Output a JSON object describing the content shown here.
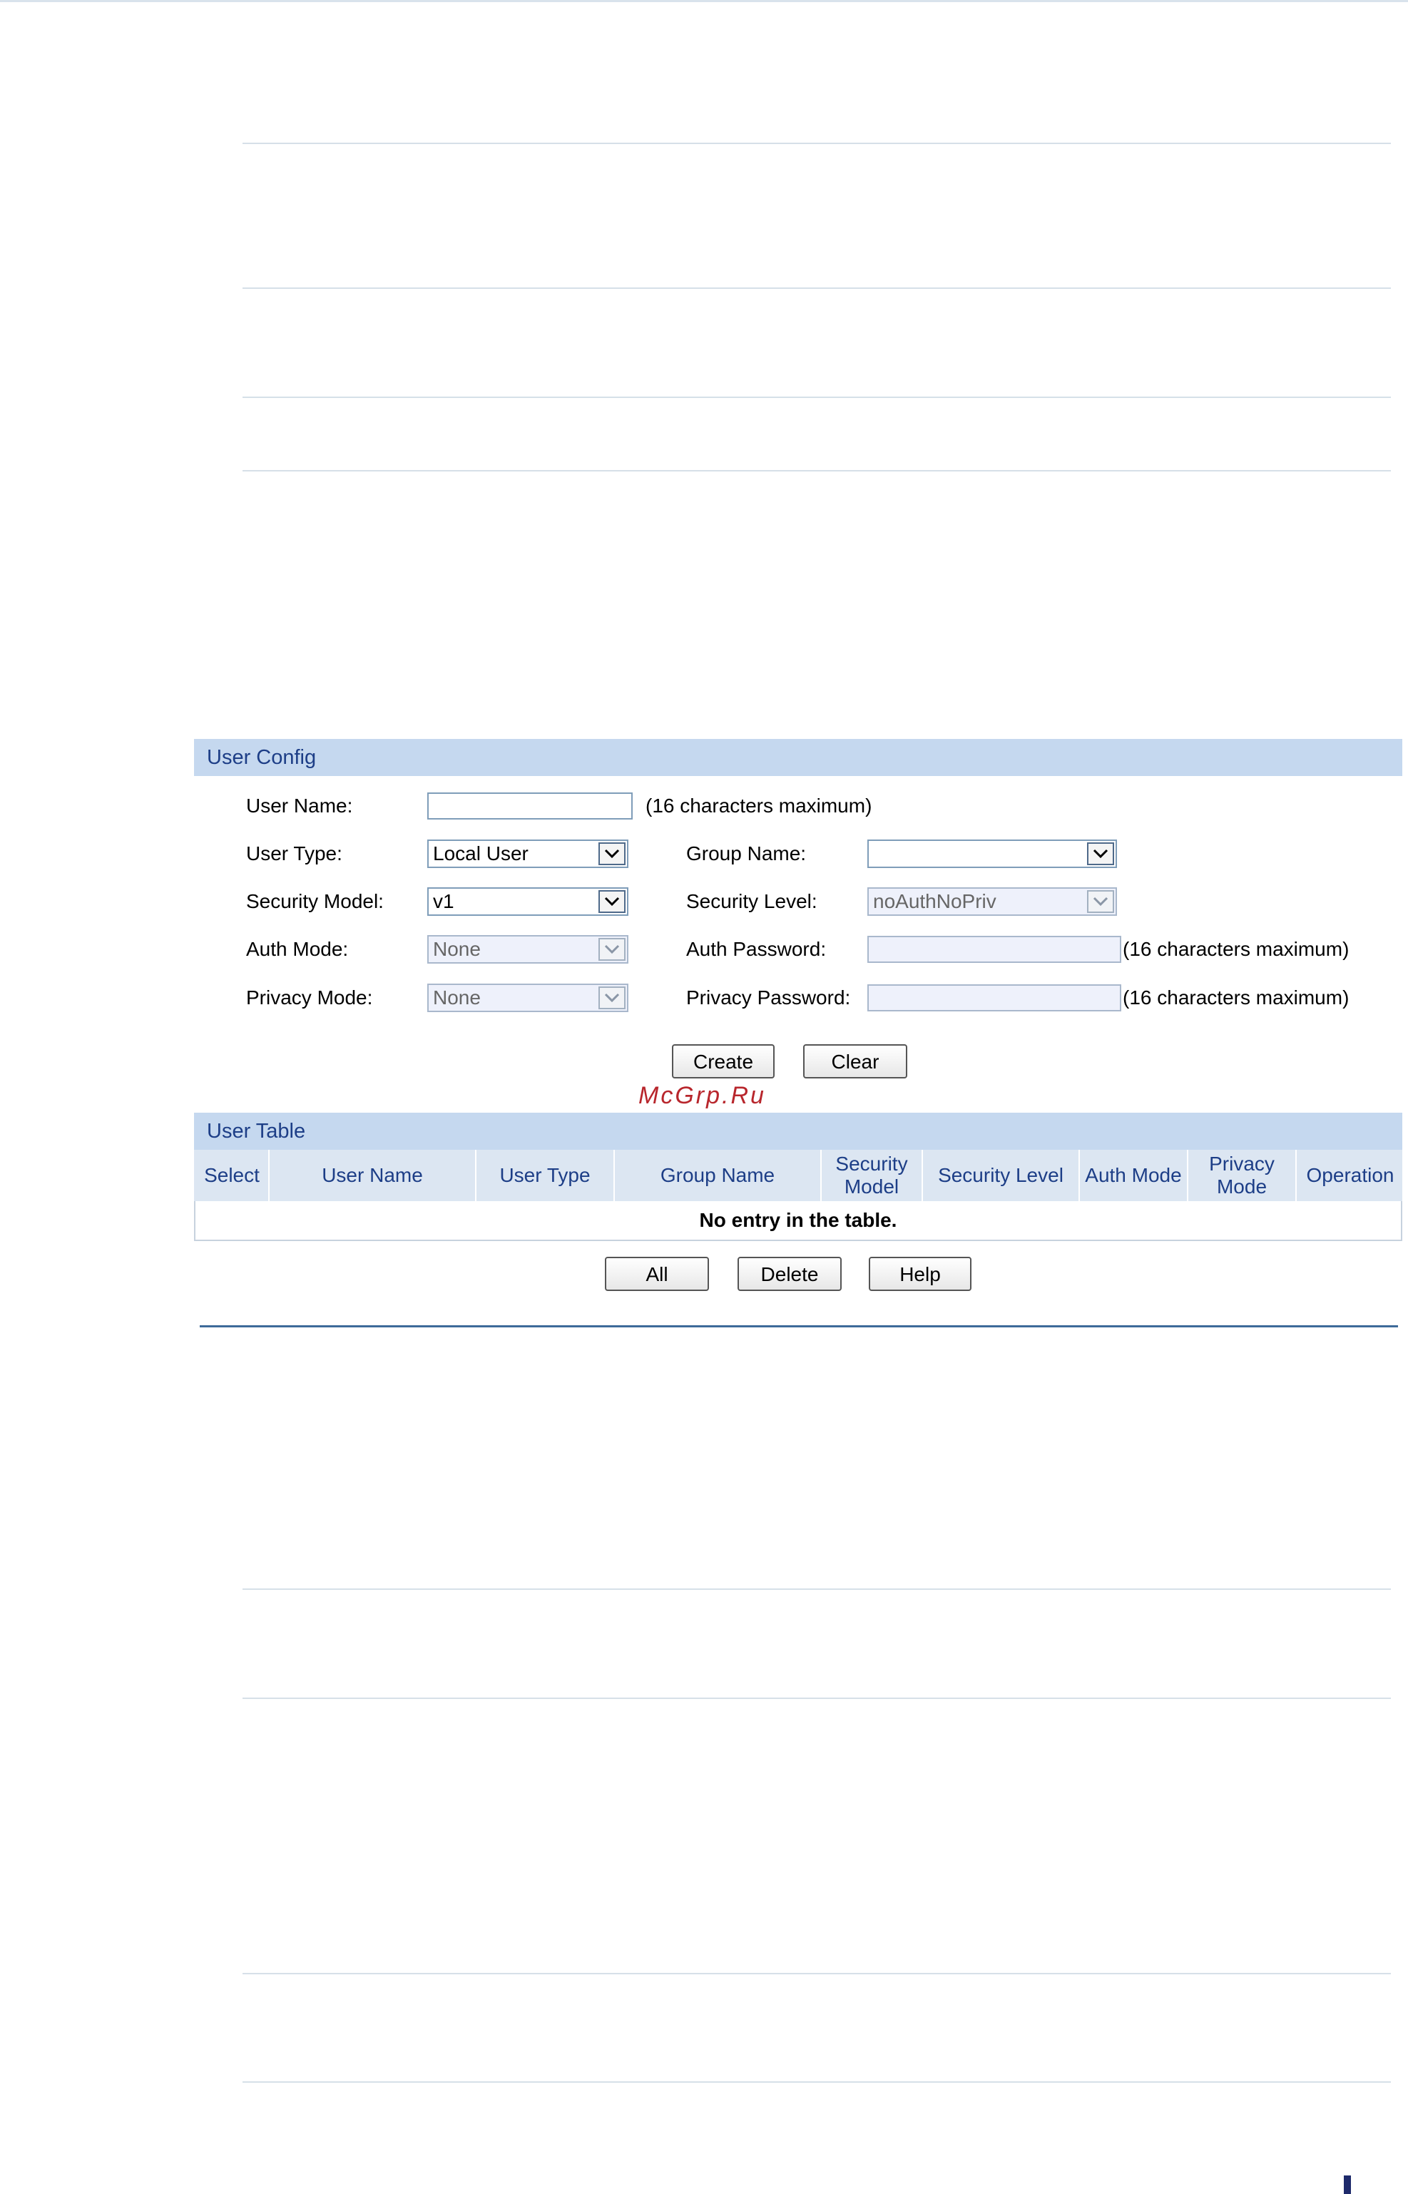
{
  "user_config": {
    "header": "User Config",
    "user_name_label": "User Name:",
    "user_name_value": "",
    "user_name_hint": "(16 characters maximum)",
    "user_type_label": "User Type:",
    "user_type_value": "Local User",
    "group_name_label": "Group Name:",
    "group_name_value": "",
    "security_model_label": "Security Model:",
    "security_model_value": "v1",
    "security_level_label": "Security Level:",
    "security_level_value": "noAuthNoPriv",
    "auth_mode_label": "Auth Mode:",
    "auth_mode_value": "None",
    "auth_password_label": "Auth Password:",
    "auth_password_hint": "(16 characters maximum)",
    "privacy_mode_label": "Privacy Mode:",
    "privacy_mode_value": "None",
    "privacy_password_label": "Privacy Password:",
    "privacy_password_hint": "(16 characters maximum)",
    "create_label": "Create",
    "clear_label": "Clear"
  },
  "watermark": "McGrp.Ru",
  "user_table": {
    "header": "User Table",
    "columns": [
      "Select",
      "User Name",
      "User Type",
      "Group Name",
      "Security Model",
      "Security Level",
      "Auth Mode",
      "Privacy Mode",
      "Operation"
    ],
    "empty_text": "No entry in the table.",
    "all_label": "All",
    "delete_label": "Delete",
    "help_label": "Help"
  },
  "colors": {
    "panel_header_bg": "#c5d8ef",
    "panel_header_text": "#1d3e87",
    "disabled_field_bg": "#eef1fb"
  }
}
